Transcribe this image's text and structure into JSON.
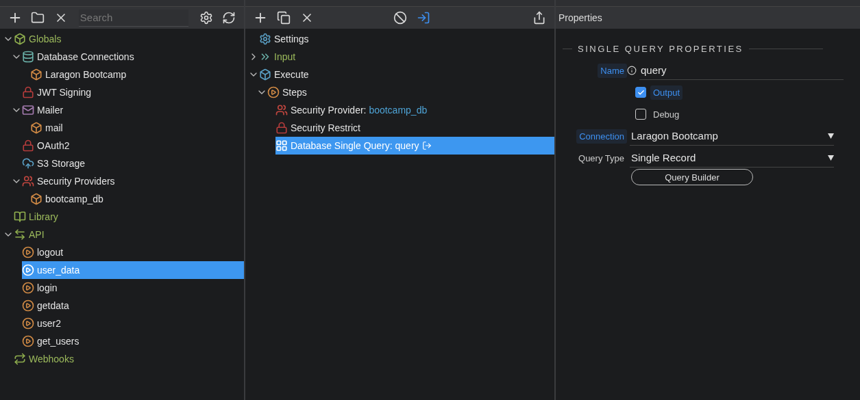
{
  "left_panel": {
    "search": {
      "placeholder": "Search"
    },
    "tree": [
      {
        "label": "Globals",
        "kind": "globals",
        "section": true,
        "expanded": true,
        "selected": false,
        "children": [
          {
            "label": "Database Connections",
            "kind": "database",
            "section": false,
            "expanded": true,
            "selected": false,
            "children": [
              {
                "label": "Laragon Bootcamp",
                "kind": "box",
                "section": false,
                "selected": false
              }
            ]
          },
          {
            "label": "JWT Signing",
            "kind": "lock",
            "section": false,
            "selected": false
          },
          {
            "label": "Mailer",
            "kind": "mail",
            "section": false,
            "expanded": true,
            "selected": false,
            "children": [
              {
                "label": "mail",
                "kind": "box",
                "section": false,
                "selected": false
              }
            ]
          },
          {
            "label": "OAuth2",
            "kind": "lock",
            "section": false,
            "selected": false
          },
          {
            "label": "S3 Storage",
            "kind": "cloud",
            "section": false,
            "selected": false
          },
          {
            "label": "Security Providers",
            "kind": "users",
            "section": false,
            "expanded": true,
            "selected": false,
            "children": [
              {
                "label": "bootcamp_db",
                "kind": "box",
                "section": false,
                "selected": false
              }
            ]
          }
        ]
      },
      {
        "label": "Library",
        "kind": "library",
        "section": true,
        "selected": false
      },
      {
        "label": "API",
        "kind": "api",
        "section": true,
        "expanded": true,
        "selected": false,
        "children": [
          {
            "label": "logout",
            "kind": "play",
            "section": false,
            "selected": false
          },
          {
            "label": "user_data",
            "kind": "play",
            "section": false,
            "selected": true
          },
          {
            "label": "login",
            "kind": "play",
            "section": false,
            "selected": false
          },
          {
            "label": "getdata",
            "kind": "play",
            "section": false,
            "selected": false
          },
          {
            "label": "user2",
            "kind": "play",
            "section": false,
            "selected": false
          },
          {
            "label": "get_users",
            "kind": "play",
            "section": false,
            "selected": false
          }
        ]
      },
      {
        "label": "Webhooks",
        "kind": "webhooks",
        "section": true,
        "selected": false
      }
    ]
  },
  "steps_panel": {
    "tree": [
      {
        "label": "Settings",
        "kind": "settings",
        "section": false,
        "selected": false
      },
      {
        "label": "Input",
        "kind": "input",
        "section": true,
        "expanded": false,
        "selected": false
      },
      {
        "label": "Execute",
        "kind": "execute",
        "section": false,
        "expanded": true,
        "selected": false,
        "children": [
          {
            "label": "Steps",
            "kind": "play",
            "section": false,
            "expanded": true,
            "selected": false,
            "children": [
              {
                "label": "Security Provider:",
                "detail": "bootcamp_db",
                "kind": "users",
                "section": false,
                "selected": false
              },
              {
                "label": "Security Restrict",
                "kind": "lock",
                "section": false,
                "selected": false
              },
              {
                "label": "Database Single Query: query",
                "kind": "table",
                "section": false,
                "selected": true,
                "output": true
              }
            ]
          }
        ]
      }
    ]
  },
  "properties_panel": {
    "title": "Properties",
    "section_title": "SINGLE QUERY PROPERTIES",
    "name": {
      "label": "Name",
      "value": "query",
      "highlighted": true
    },
    "checkboxes": [
      {
        "label": "Output",
        "checked": true,
        "highlighted": true
      },
      {
        "label": "Debug",
        "checked": false,
        "highlighted": false
      }
    ],
    "selects": [
      {
        "label": "Connection",
        "value": "Laragon Bootcamp",
        "highlighted": true
      },
      {
        "label": "Query Type",
        "value": "Single Record",
        "highlighted": false
      }
    ],
    "button": "Query Builder"
  }
}
